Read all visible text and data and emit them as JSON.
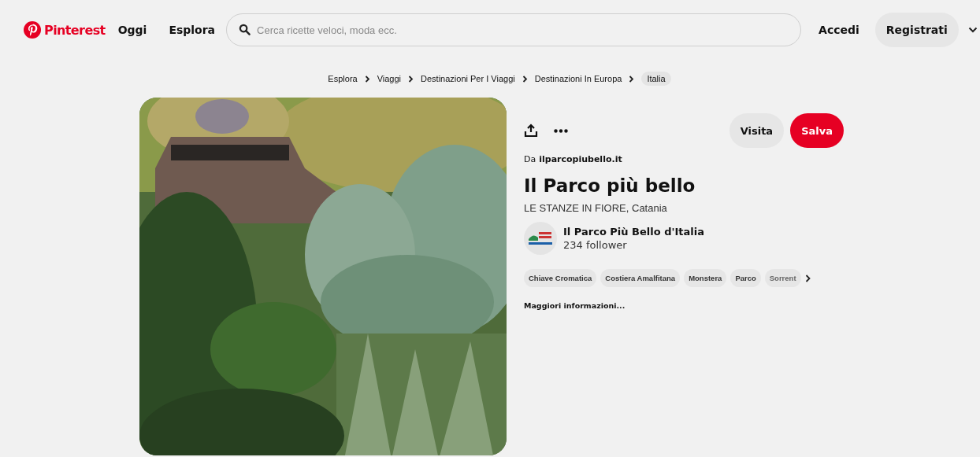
{
  "header": {
    "logo": "Pinterest",
    "nav": [
      "Oggi",
      "Esplora"
    ],
    "search": {
      "placeholder": "Cerca ricette veloci, moda ecc."
    },
    "login": "Accedi",
    "signup": "Registrati"
  },
  "breadcrumbs": [
    {
      "label": "Esplora",
      "selected": false
    },
    {
      "label": "Viaggi",
      "selected": false
    },
    {
      "label": "Destinazioni Per I Viaggi",
      "selected": false
    },
    {
      "label": "Destinazioni In Europa",
      "selected": false
    },
    {
      "label": "Italia",
      "selected": true
    }
  ],
  "pin": {
    "visit": "Visita",
    "save": "Salva",
    "source_prefix": "Da",
    "source": "ilparcopiubello.it",
    "title": "Il Parco più bello",
    "description": "LE STANZE IN FIORE, Catania",
    "author": {
      "name": "Il Parco Più Bello d'Italia",
      "followers": "234 follower"
    },
    "tags": [
      "Chiave Cromatica",
      "Costiera Amalfitana",
      "Monstera",
      "Parco",
      "Sorrent"
    ],
    "more": "Maggiori informazioni..."
  }
}
